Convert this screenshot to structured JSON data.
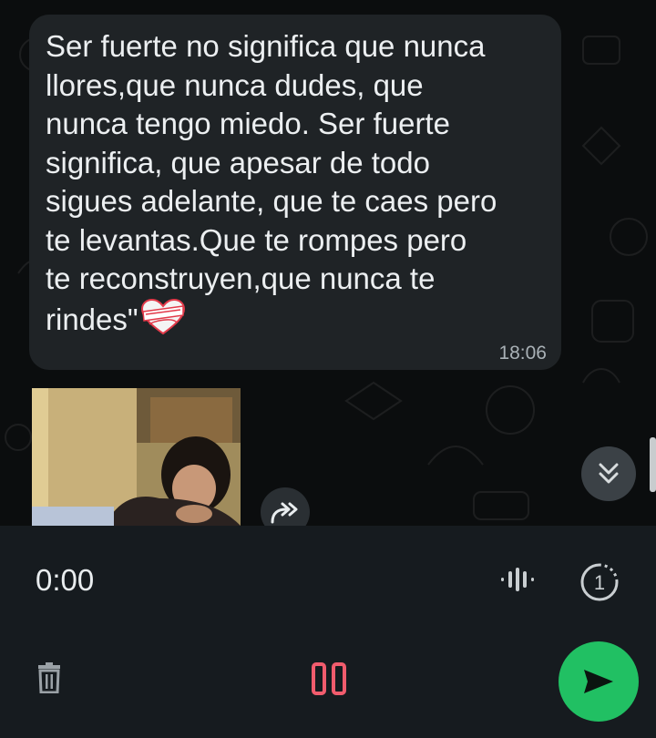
{
  "message": {
    "text": "Ser fuerte no significa que nunca\nllores,que nunca dudes, que\nnunca tengo miedo. Ser fuerte\nsignifica, que apesar de todo\nsigues adelante, que te caes pero\nte levantas.Que te rompes pero\nte reconstruyen,que nunca te\nrindes\"",
    "emoji": "heart-with-bandage",
    "time": "18:06"
  },
  "media": {
    "kind": "video-thumbnail"
  },
  "recorder": {
    "elapsed": "0:00",
    "view_once_label": "1"
  },
  "colors": {
    "accent": "#21c063",
    "pause": "#f15c6d",
    "bubble": "#1f2326",
    "recorder_bg": "#161b1f"
  },
  "icons": [
    "forward-icon",
    "scroll-down-icon",
    "waveform-icon",
    "view-once-icon",
    "trash-icon",
    "pause-icon",
    "send-icon"
  ]
}
